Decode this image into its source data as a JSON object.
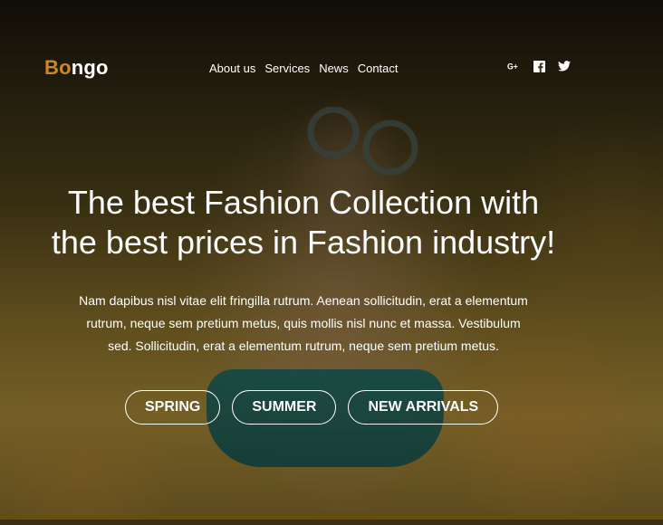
{
  "brand": {
    "accent_part": "Bo",
    "rest_part": "ngo",
    "accent_color": "#c98a1b"
  },
  "nav": {
    "items": [
      "About us",
      "Services",
      "News",
      "Contact"
    ]
  },
  "social": [
    {
      "name": "google-plus-icon",
      "glyph": "G+"
    },
    {
      "name": "facebook-icon",
      "glyph": "f"
    },
    {
      "name": "twitter-icon",
      "glyph": "t"
    }
  ],
  "hero": {
    "title_line1": "The best Fashion Collection with",
    "title_line2": "the best prices in Fashion industry!",
    "text_line1": "Nam dapibus nisl vitae elit fringilla rutrum. Aenean sollicitudin, erat a elementum",
    "text_line2": "rutrum, neque sem pretium metus, quis mollis nisl nunc et massa. Vestibulum",
    "text_line3": "sed. Sollicitudin, erat a elementum rutrum, neque sem pretium metus.",
    "buttons": [
      "SPRING",
      "SUMMER",
      "NEW ARRIVALS"
    ]
  }
}
